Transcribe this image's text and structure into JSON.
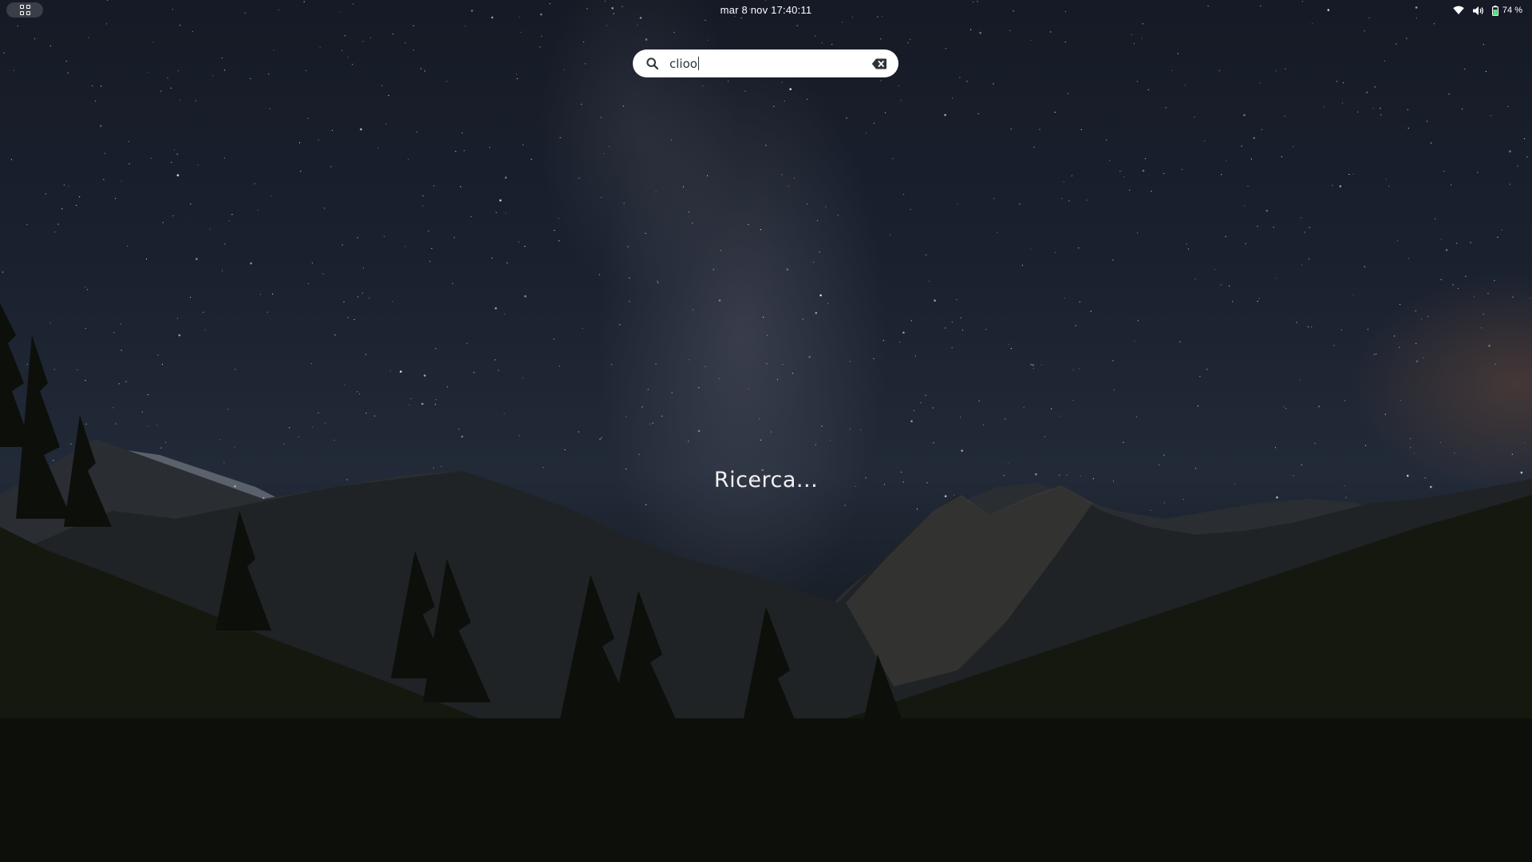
{
  "topbar": {
    "activities_icon": "apps-grid-icon",
    "clock": "mar 8 nov  17:40:11",
    "status": {
      "wifi_icon": "wifi-icon",
      "volume_icon": "volume-icon",
      "battery_icon": "battery-icon",
      "battery_percent": "74 %",
      "battery_level": 0.74,
      "battery_color": "#57e389"
    }
  },
  "search": {
    "value": "clioo",
    "search_icon": "search-icon",
    "clear_icon": "clear-icon"
  },
  "results": {
    "status_text": "Ricerca..."
  }
}
